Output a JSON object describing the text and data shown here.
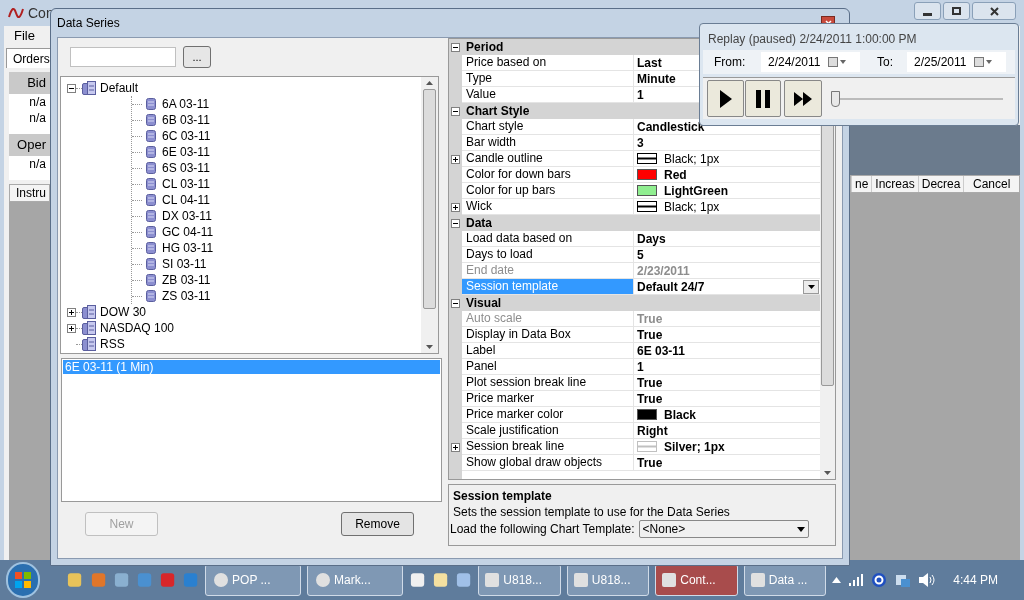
{
  "main_window": {
    "title": "Con",
    "menu": [
      "File"
    ],
    "tabs": [
      {
        "label": "Orders",
        "selected": true
      }
    ],
    "grid_sections": [
      {
        "header": "Bid",
        "rows": [
          "n/a",
          "n/a"
        ]
      },
      {
        "header": "Oper",
        "rows": [
          "n/a"
        ]
      }
    ],
    "lower_columns_left": [
      "Instru"
    ],
    "lower_columns_right": [
      "ne",
      "Increas",
      "Decrea",
      "Cancel"
    ]
  },
  "dialog": {
    "title": "Data Series",
    "browse_button": "...",
    "tree": [
      {
        "label": "Default",
        "expanded": true,
        "children": [
          {
            "label": "6A 03-11"
          },
          {
            "label": "6B 03-11"
          },
          {
            "label": "6C 03-11"
          },
          {
            "label": "6E 03-11"
          },
          {
            "label": "6S 03-11"
          },
          {
            "label": "CL 03-11"
          },
          {
            "label": "CL 04-11"
          },
          {
            "label": "DX 03-11"
          },
          {
            "label": "GC 04-11"
          },
          {
            "label": "HG 03-11"
          },
          {
            "label": "SI 03-11"
          },
          {
            "label": "ZB 03-11"
          },
          {
            "label": "ZS 03-11"
          }
        ]
      },
      {
        "label": "DOW 30",
        "expanded": false
      },
      {
        "label": "NASDAQ 100",
        "expanded": false
      },
      {
        "label": "RSS"
      }
    ],
    "series_list": [
      {
        "label": "6E 03-11 (1 Min)",
        "selected": true
      }
    ],
    "buttons": [
      {
        "label": "New",
        "disabled": true
      },
      {
        "label": "Remove",
        "disabled": false
      }
    ],
    "properties": [
      {
        "category": "Period",
        "expanded": true,
        "rows": [
          {
            "name": "Price based on",
            "value": "Last",
            "bold": true,
            "disabled": false,
            "selected": false,
            "expandable": false
          },
          {
            "name": "Type",
            "value": "Minute",
            "bold": true,
            "disabled": false,
            "selected": false,
            "expandable": false
          },
          {
            "name": "Value",
            "value": "1",
            "bold": true,
            "disabled": false,
            "selected": false,
            "expandable": false
          }
        ]
      },
      {
        "category": "Chart Style",
        "expanded": true,
        "rows": [
          {
            "name": "Chart style",
            "value": "Candlestick",
            "bold": true,
            "disabled": false,
            "selected": false,
            "expandable": false
          },
          {
            "name": "Bar width",
            "value": "3",
            "bold": true,
            "disabled": false,
            "selected": false,
            "expandable": false
          },
          {
            "name": "Candle outline",
            "value": "Black; 1px",
            "bold": false,
            "disabled": false,
            "selected": false,
            "expandable": true,
            "swatch": {
              "kind": "line",
              "color": "#000000"
            }
          },
          {
            "name": "Color for down bars",
            "value": "Red",
            "bold": true,
            "disabled": false,
            "selected": false,
            "expandable": false,
            "swatch": {
              "kind": "fill",
              "color": "#ff0000"
            }
          },
          {
            "name": "Color for up bars",
            "value": "LightGreen",
            "bold": true,
            "disabled": false,
            "selected": false,
            "expandable": false,
            "swatch": {
              "kind": "fill",
              "color": "#90ee90"
            }
          },
          {
            "name": "Wick",
            "value": "Black; 1px",
            "bold": false,
            "disabled": false,
            "selected": false,
            "expandable": true,
            "swatch": {
              "kind": "line",
              "color": "#000000"
            }
          }
        ]
      },
      {
        "category": "Data",
        "expanded": true,
        "rows": [
          {
            "name": "Load data based on",
            "value": "Days",
            "bold": true,
            "disabled": false,
            "selected": false,
            "expandable": false
          },
          {
            "name": "Days to load",
            "value": "5",
            "bold": true,
            "disabled": false,
            "selected": false,
            "expandable": false
          },
          {
            "name": "End date",
            "value": "2/23/2011",
            "bold": true,
            "disabled": true,
            "selected": false,
            "expandable": false
          },
          {
            "name": "Session template",
            "value": "Default 24/7",
            "bold": true,
            "disabled": false,
            "selected": true,
            "expandable": false,
            "dropdown": true
          }
        ]
      },
      {
        "category": "Visual",
        "expanded": true,
        "rows": [
          {
            "name": "Auto scale",
            "value": "True",
            "bold": true,
            "disabled": true,
            "selected": false,
            "expandable": false
          },
          {
            "name": "Display in Data Box",
            "value": "True",
            "bold": true,
            "disabled": false,
            "selected": false,
            "expandable": false
          },
          {
            "name": "Label",
            "value": "6E 03-11",
            "bold": true,
            "disabled": false,
            "selected": false,
            "expandable": false
          },
          {
            "name": "Panel",
            "value": "1",
            "bold": true,
            "disabled": false,
            "selected": false,
            "expandable": false
          },
          {
            "name": "Plot session break line",
            "value": "True",
            "bold": true,
            "disabled": false,
            "selected": false,
            "expandable": false
          },
          {
            "name": "Price marker",
            "value": "True",
            "bold": true,
            "disabled": false,
            "selected": false,
            "expandable": false
          },
          {
            "name": "Price marker color",
            "value": "Black",
            "bold": true,
            "disabled": false,
            "selected": false,
            "expandable": false,
            "swatch": {
              "kind": "fill",
              "color": "#000000"
            }
          },
          {
            "name": "Scale justification",
            "value": "Right",
            "bold": true,
            "disabled": false,
            "selected": false,
            "expandable": false
          },
          {
            "name": "Session break line",
            "value": "Silver; 1px",
            "bold": true,
            "disabled": false,
            "selected": false,
            "expandable": true,
            "swatch": {
              "kind": "line",
              "color": "#c0c0c0"
            }
          },
          {
            "name": "Show global draw objects",
            "value": "True",
            "bold": true,
            "disabled": false,
            "selected": false,
            "expandable": false
          }
        ]
      }
    ],
    "description": {
      "title": "Session template",
      "text": "Sets the session template to use for the Data Series"
    },
    "chart_template": {
      "label": "Load the following Chart Template:",
      "value": "<None>"
    }
  },
  "replay": {
    "title": "Replay (paused) 2/24/2011 1:00:00 PM",
    "from_label": "From:",
    "from": "2/24/2011",
    "to_label": "To:",
    "to": "2/25/2011",
    "level": 0
  },
  "taskbar": {
    "tasks": [
      {
        "label": "POP ...",
        "active": false
      },
      {
        "label": "Mark...",
        "active": false
      },
      {
        "label": "U818...",
        "active": false
      },
      {
        "label": "U818...",
        "active": false
      },
      {
        "label": "Cont...",
        "active": true
      },
      {
        "label": "Data ...",
        "active": false
      }
    ],
    "clock": "4:44 PM"
  }
}
